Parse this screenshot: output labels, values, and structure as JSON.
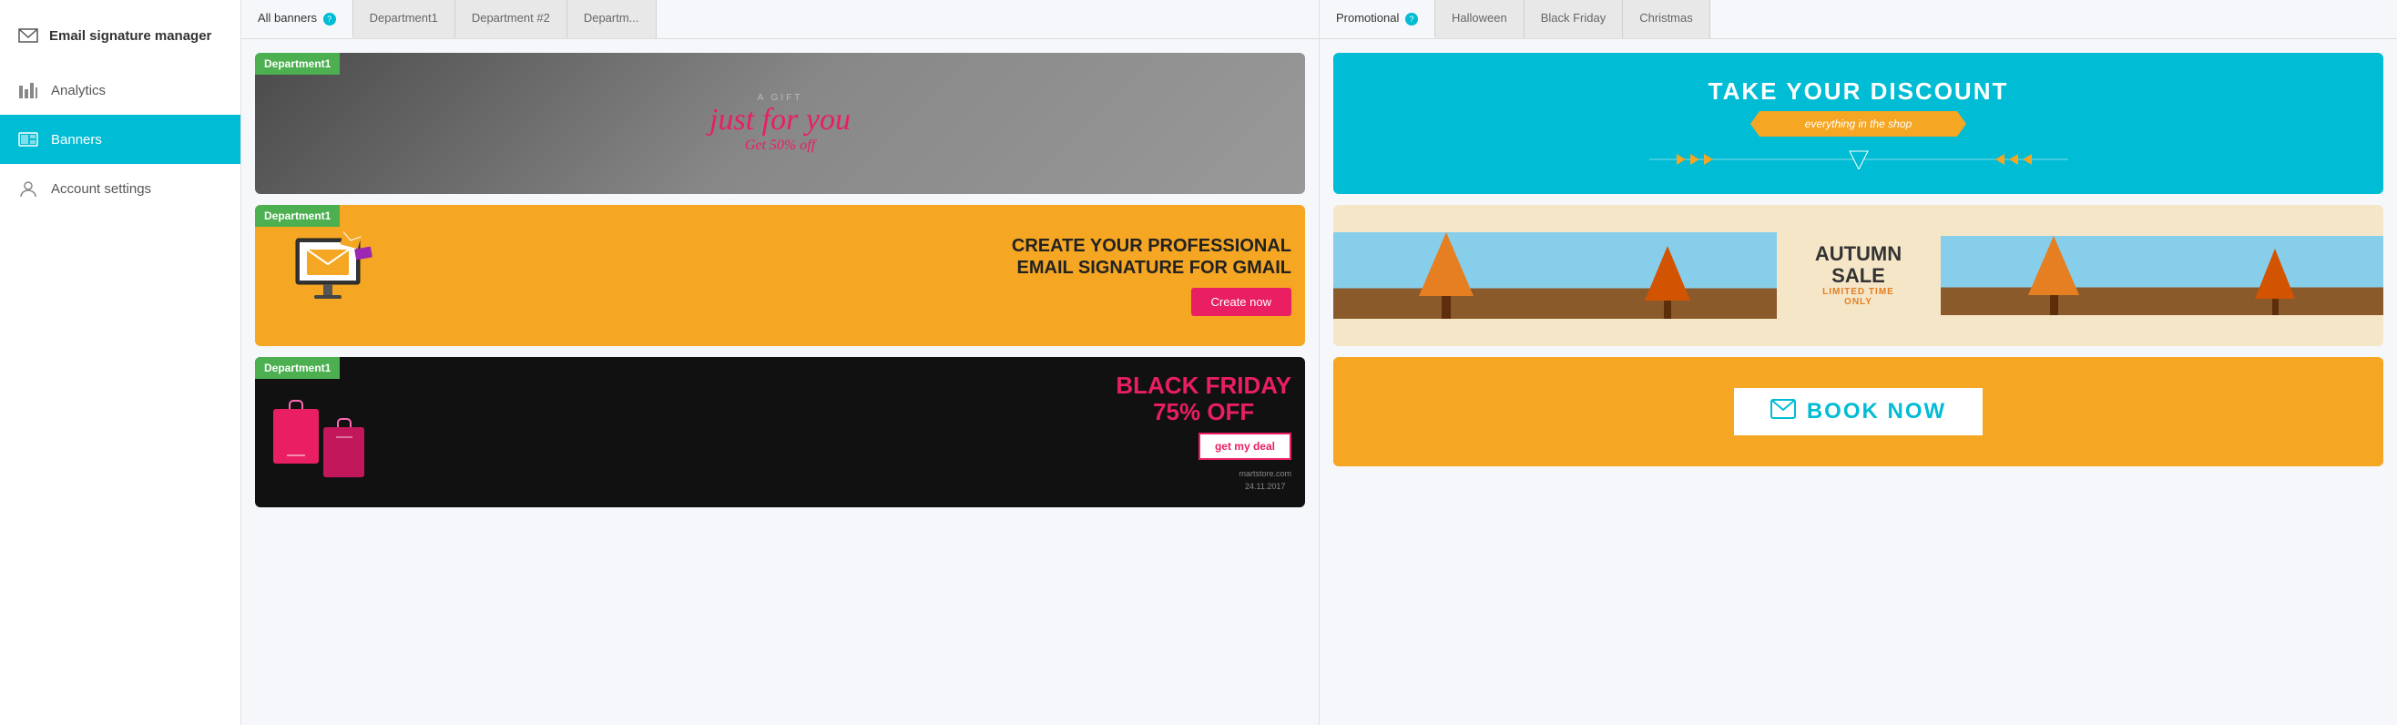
{
  "sidebar": {
    "logo_text": "Email signature manager",
    "items": [
      {
        "id": "email-manager",
        "label": "Email signature manager",
        "active": false
      },
      {
        "id": "analytics",
        "label": "Analytics",
        "active": false
      },
      {
        "id": "banners",
        "label": "Banners",
        "active": true
      },
      {
        "id": "account-settings",
        "label": "Account settings",
        "active": false
      }
    ]
  },
  "left_panel": {
    "tabs": [
      {
        "id": "all-banners",
        "label": "All banners",
        "has_help": true,
        "active": true
      },
      {
        "id": "department1",
        "label": "Department1",
        "active": false
      },
      {
        "id": "department2",
        "label": "Department #2",
        "active": false
      },
      {
        "id": "departmentN",
        "label": "Departm...",
        "active": false
      }
    ],
    "banners": [
      {
        "id": "gift-banner",
        "dept_badge": "Department1",
        "type": "gift",
        "small_text": "A GIFT",
        "script_text": "just for you",
        "off_text": "Get 50% off"
      },
      {
        "id": "email-banner",
        "dept_badge": "Department1",
        "type": "email",
        "title_line1": "CREATE YOUR PROFESSIONAL",
        "title_line2": "EMAIL SIGNATURE FOR GMAIL",
        "btn_label": "Create now"
      },
      {
        "id": "bf-banner",
        "dept_badge": "Department1",
        "type": "blackfriday",
        "title": "BLACK FRIDAY",
        "subtitle": "75% OFF",
        "deal_label": "get my deal",
        "store_text": "martstore.com",
        "date_text": "24.11.2017"
      }
    ]
  },
  "right_panel": {
    "tabs": [
      {
        "id": "promotional",
        "label": "Promotional",
        "has_help": true,
        "active": true
      },
      {
        "id": "halloween",
        "label": "Halloween",
        "active": false
      },
      {
        "id": "black-friday",
        "label": "Black Friday",
        "active": false
      },
      {
        "id": "christmas",
        "label": "Christmas",
        "active": false
      }
    ],
    "banners": [
      {
        "id": "blue-discount-banner",
        "type": "blue-discount",
        "title": "TAKE YOUR DISCOUNT",
        "subtitle": "everything in the shop"
      },
      {
        "id": "autumn-banner",
        "type": "autumn",
        "sale_title": "AUTUMN\nSALE",
        "sale_line1": "AUTUMN",
        "sale_line2": "SALE",
        "sale_sub": "LIMITED TIME\nONLY",
        "sale_sub1": "LIMITED TIME",
        "sale_sub2": "ONLY"
      },
      {
        "id": "booknow-banner",
        "type": "booknow",
        "label": "BOOK NOW"
      }
    ]
  },
  "help_icon_label": "?",
  "colors": {
    "active_tab_border": "#00bcd4",
    "sidebar_active_bg": "#00bcd4",
    "dept_badge_bg": "#4caf50",
    "blue_banner_bg": "#00bcd4",
    "orange": "#f5a623",
    "pink": "#e91e63"
  }
}
